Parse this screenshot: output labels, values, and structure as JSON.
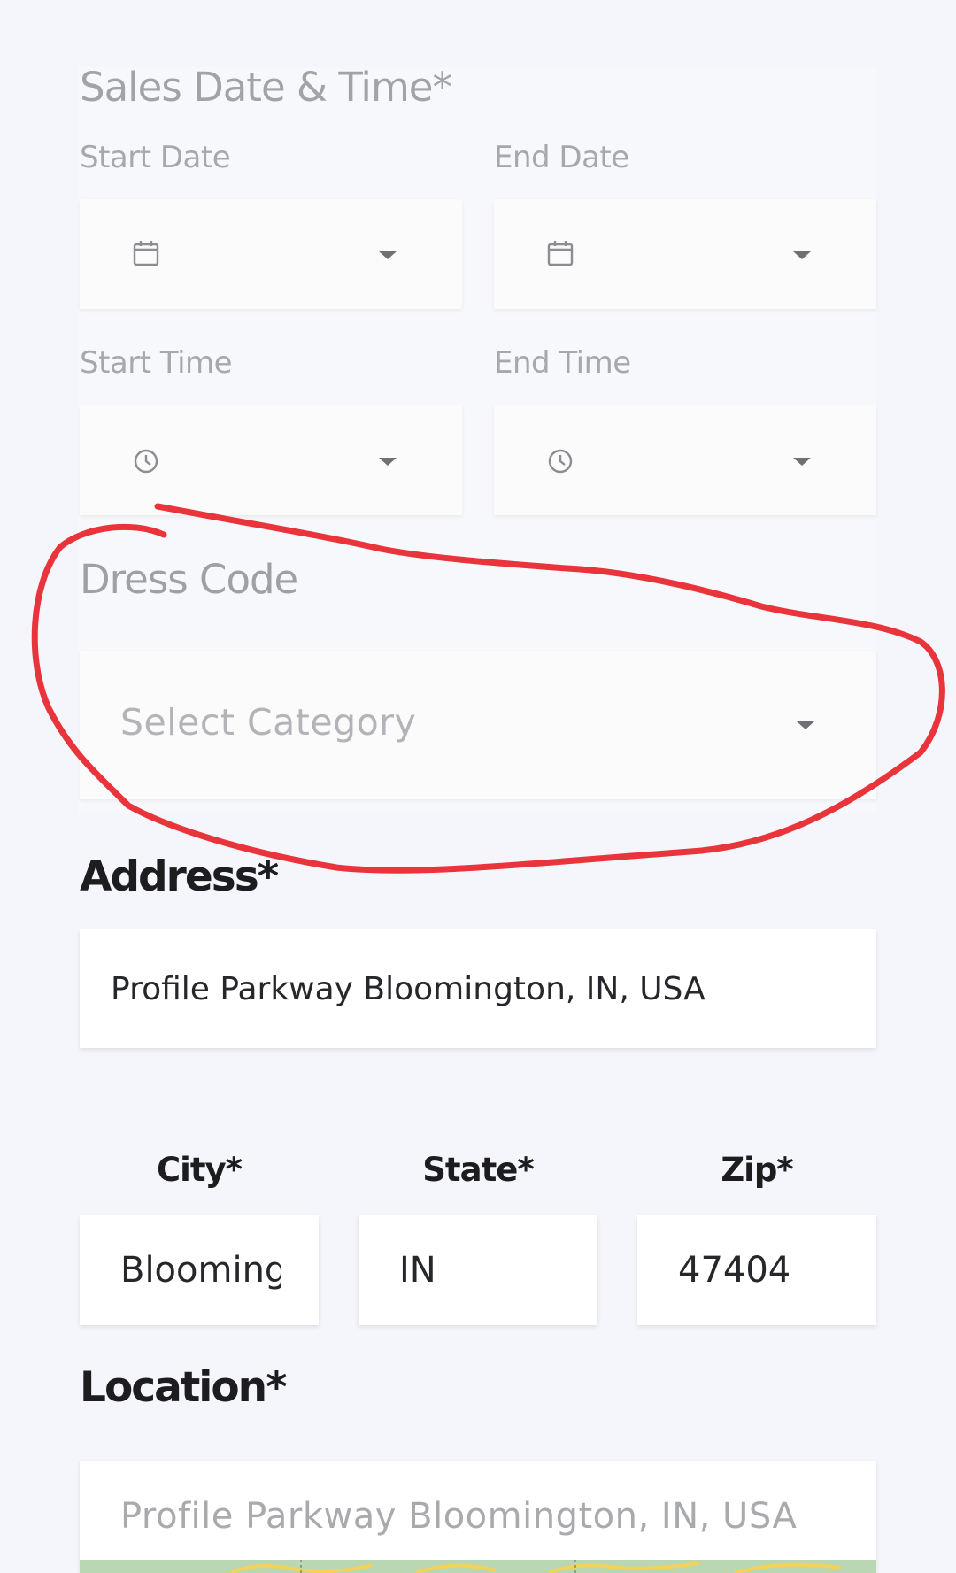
{
  "sales": {
    "title": "Sales Date & Time*",
    "start_date_label": "Start Date",
    "end_date_label": "End Date",
    "start_time_label": "Start Time",
    "end_time_label": "End Time"
  },
  "dress_code": {
    "label": "Dress Code",
    "placeholder": "Select Category"
  },
  "address": {
    "label": "Address*",
    "value": "Profile Parkway Bloomington, IN, USA"
  },
  "city": {
    "label": "City*",
    "value": "Bloomington"
  },
  "state": {
    "label": "State*",
    "value": "IN"
  },
  "zip": {
    "label": "Zip*",
    "value": "47404"
  },
  "location": {
    "label": "Location*",
    "placeholder": "Profile Parkway Bloomington, IN, USA"
  },
  "colors": {
    "background": "#f4f6fc",
    "annotation": "#e8343a",
    "muted_text": "#a2a3a7"
  },
  "icons": {
    "date": "calendar-icon",
    "time": "clock-icon",
    "dropdown": "caret-down-icon"
  }
}
